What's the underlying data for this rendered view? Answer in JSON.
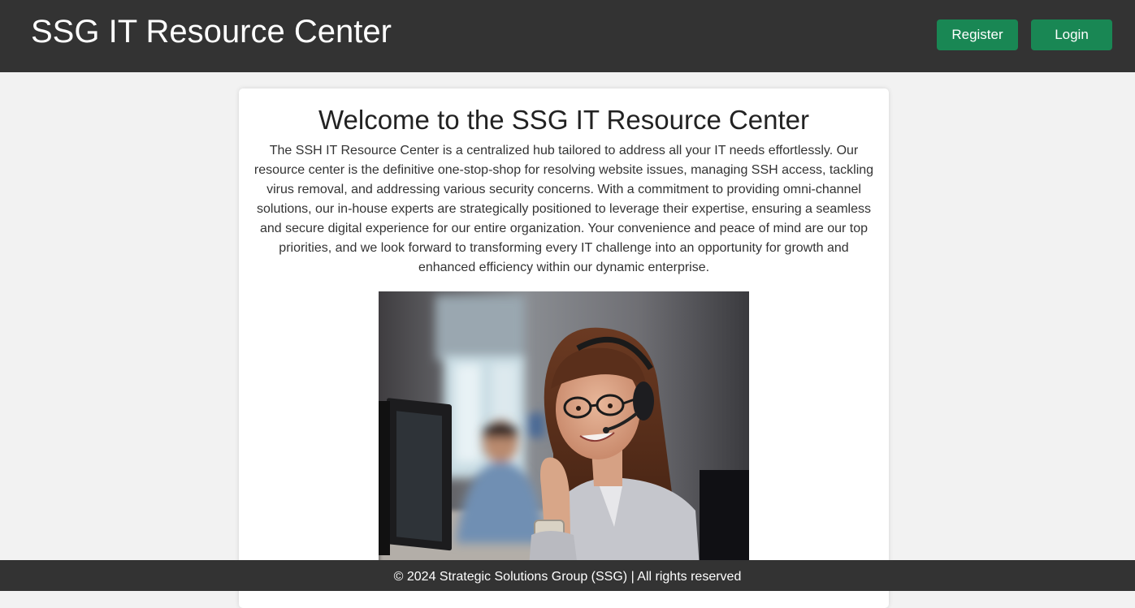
{
  "header": {
    "title": "SSG IT Resource Center",
    "register_label": "Register",
    "login_label": "Login"
  },
  "main": {
    "heading": "Welcome to the SSG IT Resource Center",
    "intro": "The SSH IT Resource Center is a centralized hub tailored to address all your IT needs effortlessly. Our resource center is the definitive one-stop-shop for resolving website issues, managing SSH access, tackling virus removal, and addressing various security concerns. With a commitment to providing omni-channel solutions, our in-house experts are strategically positioned to leverage their expertise, ensuring a seamless and secure digital experience for our entire organization. Your convenience and peace of mind are our top priorities, and we look forward to transforming every IT challenge into an opportunity for growth and enhanced efficiency within our dynamic enterprise."
  },
  "footer": {
    "text": "© 2024 Strategic Solutions Group (SSG) | All rights reserved"
  },
  "colors": {
    "header_bg": "#333333",
    "button_green": "#198754",
    "page_bg": "#f2f2f2"
  }
}
